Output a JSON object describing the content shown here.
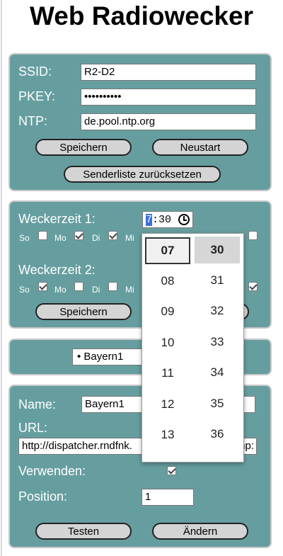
{
  "app": {
    "title": "Web Radiowecker"
  },
  "wifi": {
    "ssid_label": "SSID:",
    "ssid_value": "R2-D2",
    "pkey_label": "PKEY:",
    "pkey_value": "••••••••••",
    "ntp_label": "NTP:",
    "ntp_value": "de.pool.ntp.org",
    "save_label": "Speichern",
    "restart_label": "Neustart",
    "reset_list_label": "Senderliste zurücksetzen"
  },
  "alarms": {
    "alarm1_label": "Weckerzeit 1:",
    "alarm1_hour": "7",
    "alarm1_rest": ":30",
    "alarm2_label": "Weckerzeit 2:",
    "days": [
      "So",
      "Mo",
      "Di",
      "Mi"
    ],
    "save_label": "Speichern"
  },
  "timepicker": {
    "hours": [
      "07",
      "08",
      "09",
      "10",
      "11",
      "12",
      "13"
    ],
    "minutes": [
      "30",
      "31",
      "32",
      "33",
      "34",
      "35",
      "36"
    ]
  },
  "station_select": {
    "selected": "• Bayern1"
  },
  "station_edit": {
    "name_label": "Name:",
    "name_value": "Bayern1",
    "url_label": "URL:",
    "url_value": "http://dispatcher.rndfnk.",
    "url_tail": "mp:",
    "use_label": "Verwenden:",
    "position_label": "Position:",
    "position_value": "1",
    "test_label": "Testen",
    "change_label": "Ändern"
  },
  "icons": {
    "clock": "clock-icon",
    "checkbox_check": "check-icon"
  },
  "colors": {
    "panel": "#669ea0",
    "button": "#d4d4d4",
    "highlight": "#3a6ee0"
  }
}
